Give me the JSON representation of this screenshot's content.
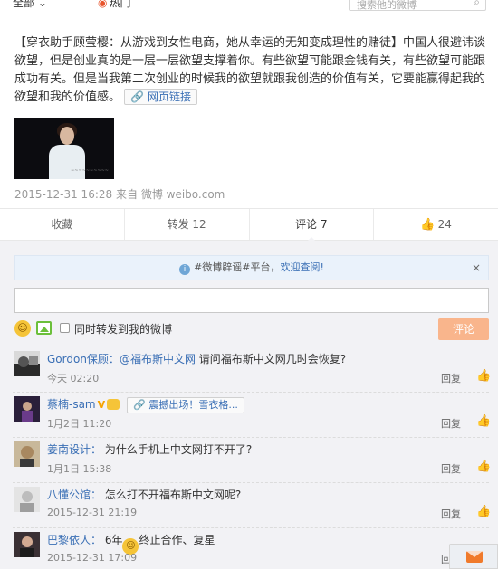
{
  "topbar": {
    "filter_label": "全部 ⌄",
    "hot_label": "热门",
    "search_placeholder": "搜索他的微博"
  },
  "post": {
    "text": "【穿衣助手顾莹樱：从游戏到女性电商，她从幸运的无知变成理性的赌徒】中国人很避讳谈欲望，但是创业真的是一层一层欲望支撑着你。有些欲望可能跟金钱有关，有些欲望可能跟成功有关。但是当我第二次创业的时候我的欲望就跟我创造的价值有关，它要能赢得起我的欲望和我的价值感。",
    "link_label": "网页链接",
    "photo_caption": "~~~~~~~~~~",
    "time": "2015-12-31 16:28",
    "source_prefix": "来自",
    "source": "微博 weibo.com"
  },
  "actions": {
    "favorite": "收藏",
    "repost": "转发 12",
    "comment": "评论 7",
    "like_count": "24"
  },
  "notice": {
    "prefix": "#微博辟谣#平台，",
    "highlight": "欢迎查阅!",
    "close": "×"
  },
  "compose": {
    "repost_label": "同时转发到我的微博",
    "submit_label": "评论"
  },
  "comments": [
    {
      "user": "Gordon保顾：",
      "mention": "@福布斯中文网",
      "text": " 请问福布斯中文网几时会恢复?",
      "time": "今天 02:20",
      "reply": "回复"
    },
    {
      "user": "蔡楠-sam",
      "chip": "震撼出场！雪衣格...",
      "time": "1月2日 11:20",
      "reply": "回复"
    },
    {
      "user": "姜南设计：",
      "text": " 为什么手机上中文网打不开了?",
      "time": "1月1日 15:38",
      "reply": "回复"
    },
    {
      "user": "八懂公馆：",
      "text": " 怎么打不开福布斯中文网呢?",
      "time": "2015-12-31 21:19",
      "reply": "回复"
    },
    {
      "user": "巴黎依人：",
      "text_before": " 6年",
      "text_after": "终止合作、复星",
      "time": "2015-12-31 17:09",
      "reply": "回复"
    }
  ],
  "colors": {
    "link_blue": "#3a6fb5",
    "submit_orange": "#f9b58c",
    "panel_bg": "#f2f2f5"
  }
}
